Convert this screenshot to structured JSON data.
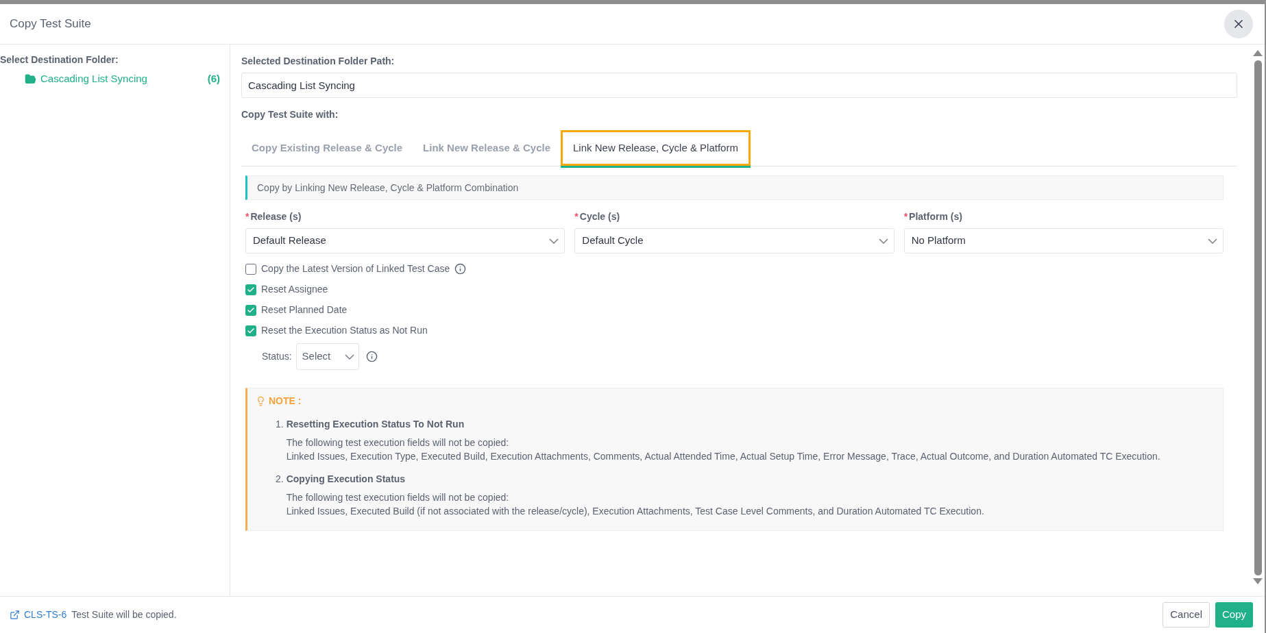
{
  "dialog": {
    "title": "Copy Test Suite"
  },
  "folder_panel": {
    "heading": "Select Destination Folder:",
    "folders": [
      {
        "name": "Cascading List Syncing",
        "count": "(6)",
        "selected": true
      }
    ]
  },
  "path": {
    "label": "Selected Destination Folder Path:",
    "value": "Cascading List Syncing"
  },
  "copy_with_label": "Copy Test Suite with:",
  "tabs": [
    {
      "label": "Copy Existing Release & Cycle",
      "selected": false
    },
    {
      "label": "Link New Release & Cycle",
      "selected": false
    },
    {
      "label": "Link New Release, Cycle & Platform",
      "selected": true
    }
  ],
  "info_banner": "Copy by Linking New Release, Cycle & Platform Combination",
  "selects": [
    {
      "label": "Release (s)",
      "required_mark": "*",
      "value": "Default Release"
    },
    {
      "label": "Cycle (s)",
      "required_mark": "*",
      "value": "Default Cycle"
    },
    {
      "label": "Platform (s)",
      "required_mark": "*",
      "value": "No Platform"
    }
  ],
  "options": [
    {
      "label": "Copy the Latest Version of Linked Test Case",
      "checked": false,
      "info": true
    },
    {
      "label": "Reset Assignee",
      "checked": true,
      "info": false
    },
    {
      "label": "Reset Planned Date",
      "checked": true,
      "info": false
    },
    {
      "label": "Reset the Execution Status as Not Run",
      "checked": true,
      "info": false
    }
  ],
  "status": {
    "label": "Status:",
    "value": "Select"
  },
  "note": {
    "title": "NOTE :",
    "items": [
      {
        "number": "1.",
        "heading": "Resetting Execution Status To Not Run",
        "lines": [
          "The following test execution fields will not be copied:",
          "Linked Issues, Execution Type, Executed Build, Execution Attachments, Comments, Actual Attended Time, Actual Setup Time, Error Message, Trace, Actual Outcome, and Duration Automated TC Execution."
        ]
      },
      {
        "number": "2.",
        "heading": "Copying Execution Status",
        "lines": [
          "The following test execution fields will not be copied:",
          "Linked Issues, Executed Build (if not associated with the release/cycle), Execution Attachments, Test Case Level Comments, and Duration Automated TC Execution."
        ]
      }
    ]
  },
  "footer": {
    "link": "CLS-TS-6",
    "message": "Test Suite will be copied.",
    "buttons": [
      {
        "label": "Cancel",
        "kind": "default"
      },
      {
        "label": "Copy",
        "kind": "primary"
      }
    ]
  }
}
